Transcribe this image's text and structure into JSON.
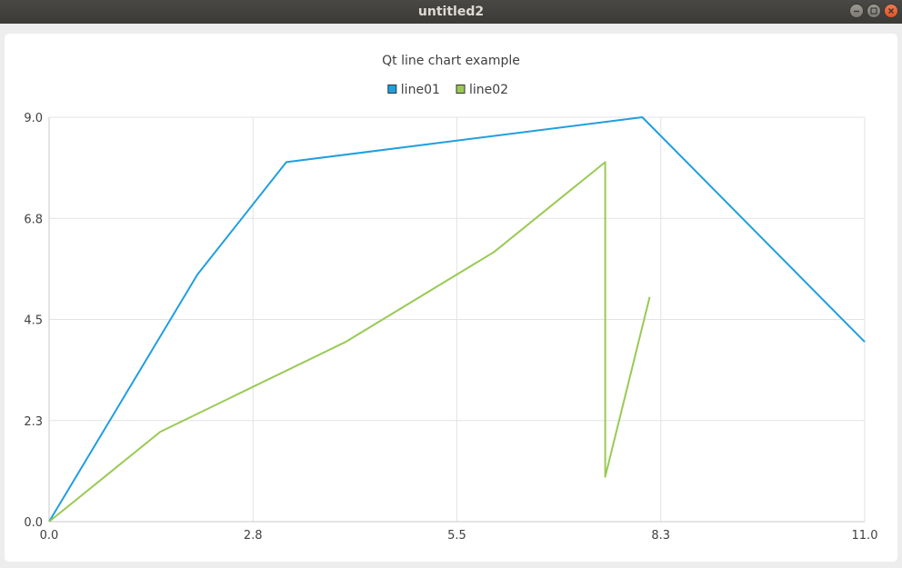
{
  "window": {
    "title": "untitled2",
    "controls": [
      "minimize-icon",
      "maximize-icon",
      "close-icon"
    ]
  },
  "chart_data": {
    "type": "line",
    "title": "Qt line chart example",
    "xlabel": "",
    "ylabel": "",
    "xlim": [
      0,
      11
    ],
    "ylim": [
      0,
      9
    ],
    "x_ticks": [
      "0.0",
      "2.8",
      "5.5",
      "8.3",
      "11.0"
    ],
    "y_ticks": [
      "0.0",
      "2.3",
      "4.5",
      "6.8",
      "9.0"
    ],
    "grid": true,
    "legend_position": "top-center",
    "series": [
      {
        "name": "line01",
        "color": "#209fdf",
        "points": [
          [
            0,
            0
          ],
          [
            2,
            5.5
          ],
          [
            3.2,
            8
          ],
          [
            8,
            9
          ],
          [
            11,
            4
          ]
        ]
      },
      {
        "name": "line02",
        "color": "#99ca53",
        "points": [
          [
            0,
            0
          ],
          [
            1.5,
            2
          ],
          [
            4,
            4
          ],
          [
            6,
            6
          ],
          [
            7.5,
            8
          ],
          [
            7.5,
            1
          ],
          [
            8.1,
            5
          ]
        ]
      }
    ]
  }
}
